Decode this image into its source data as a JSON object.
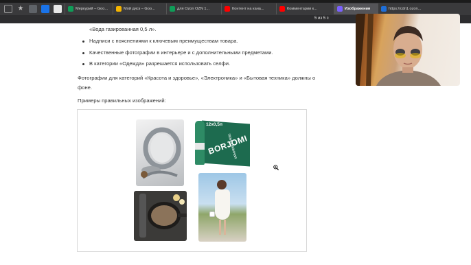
{
  "browser": {
    "tabs": [
      {
        "label": "Меркурий – Goo...",
        "color": "#0f9d58"
      },
      {
        "label": "Мой диск – Goo...",
        "color": "#f4b400"
      },
      {
        "label": "для Ozon OZN 1...",
        "color": "#0f9d58"
      },
      {
        "label": "Контент на кана...",
        "color": "#ff0000"
      },
      {
        "label": "Комментарии к...",
        "color": "#ff0000"
      },
      {
        "label": "Изображения",
        "color": "#7b61ff",
        "active": true
      },
      {
        "label": "https://cdn1.ozon...",
        "color": "#1e6fd9"
      }
    ],
    "find_counter": "5 из 5 с"
  },
  "content": {
    "line_water": "«Вода газированная 0,5 л».",
    "bullets": [
      "Надписи с пояснениями к ключевым преимуществам товара.",
      "Качественные фотографии в интерьере и с дополнительными предметами.",
      "В категории «Одежда» разрешается использовать селфи."
    ],
    "paragraph_1": "Фотографии для категорий «Красота и здоровье», «Электроника» и «Бытовая техника» должны о",
    "paragraph_2": "фоне.",
    "examples_heading": "Примеры правильных изображений:",
    "bottle_brand": "BORJOMI",
    "bottle_pack": "12x0,5л",
    "bottle_type": "газированная"
  }
}
